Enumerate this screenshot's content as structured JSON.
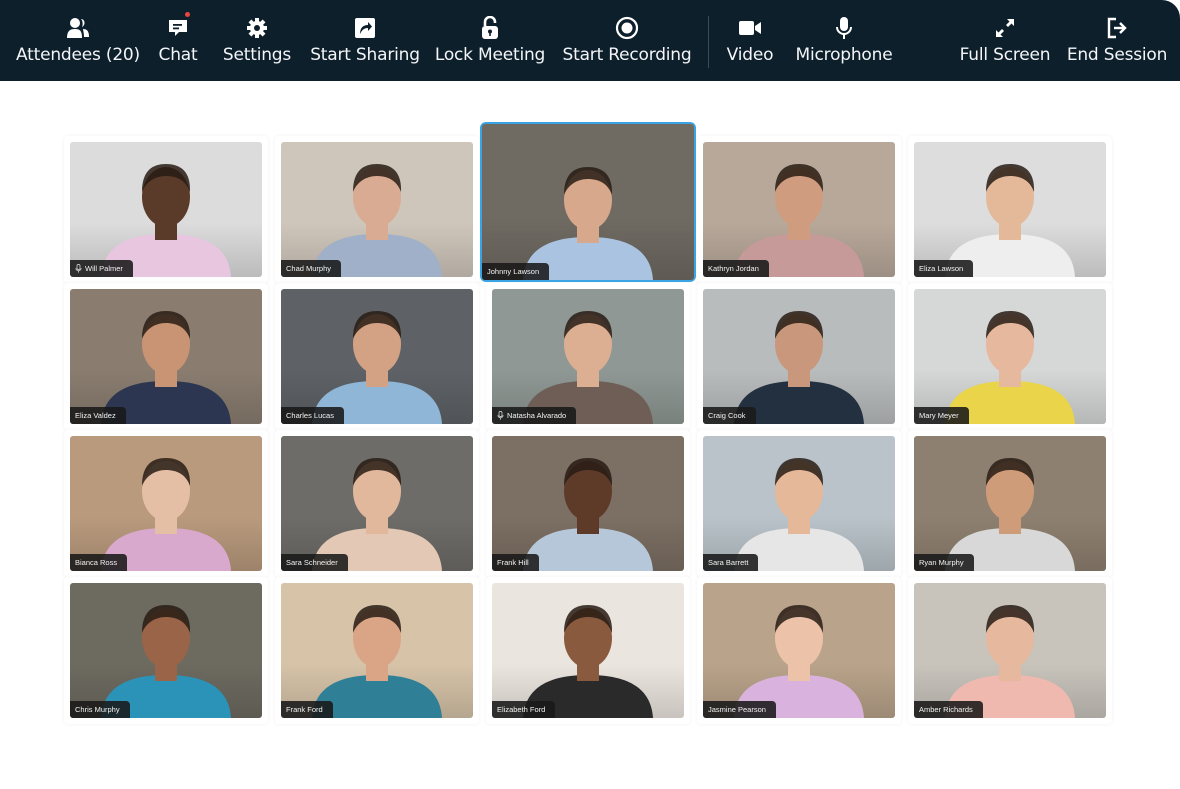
{
  "toolbar": {
    "items": [
      {
        "id": "attendees",
        "label": "Attendees (20)",
        "icon": "users-icon"
      },
      {
        "id": "chat",
        "label": "Chat",
        "icon": "chat-icon",
        "has_notification": true
      },
      {
        "id": "settings",
        "label": "Settings",
        "icon": "gear-icon"
      },
      {
        "id": "start-sharing",
        "label": "Start Sharing",
        "icon": "share-icon"
      },
      {
        "id": "lock-meeting",
        "label": "Lock Meeting",
        "icon": "unlock-icon"
      },
      {
        "id": "start-recording",
        "label": "Start Recording",
        "icon": "record-icon"
      },
      {
        "id": "video",
        "label": "Video",
        "icon": "video-camera-icon"
      },
      {
        "id": "microphone",
        "label": "Microphone",
        "icon": "microphone-icon"
      },
      {
        "id": "full-screen",
        "label": "Full Screen",
        "icon": "expand-icon"
      },
      {
        "id": "end-session",
        "label": "End Session",
        "icon": "exit-icon"
      }
    ],
    "notification_color": "#e8453c"
  },
  "colors": {
    "toolbar_bg": "#0e1f2c",
    "active_speaker_border": "#3aa3e3"
  },
  "participants": [
    {
      "name": "Will Palmer",
      "muted_icon": true,
      "bg": "#dcdcdc",
      "skin": "#5a3a28",
      "shirt": "#e8c6e0"
    },
    {
      "name": "Chad Murphy",
      "muted_icon": false,
      "bg": "#cfc6bb",
      "skin": "#d9ab92",
      "shirt": "#9fb0c8"
    },
    {
      "name": "Johnny Lawson",
      "muted_icon": false,
      "active": true,
      "bg": "#6f6a62",
      "skin": "#d7a88c",
      "shirt": "#a9c3e0"
    },
    {
      "name": "Kathryn Jordan",
      "muted_icon": false,
      "bg": "#b8a89a",
      "skin": "#cf9c80",
      "shirt": "#c79a9a"
    },
    {
      "name": "Eliza Lawson",
      "muted_icon": false,
      "bg": "#dddddd",
      "skin": "#e3b99a",
      "shirt": "#eeeeee"
    },
    {
      "name": "Eliza Valdez",
      "muted_icon": false,
      "bg": "#8a7d70",
      "skin": "#c89474",
      "shirt": "#2d3650"
    },
    {
      "name": "Charles Lucas",
      "muted_icon": false,
      "bg": "#5e6266",
      "skin": "#d3a184",
      "shirt": "#8fb6d6"
    },
    {
      "name": "Natasha Alvarado",
      "muted_icon": true,
      "bg": "#8f9894",
      "skin": "#dcae92",
      "shirt": "#6e5e56"
    },
    {
      "name": "Craig Cook",
      "muted_icon": false,
      "bg": "#b9bcbd",
      "skin": "#c9987c",
      "shirt": "#22303f"
    },
    {
      "name": "Mary Meyer",
      "muted_icon": false,
      "bg": "#d5d8d6",
      "skin": "#e6b89e",
      "shirt": "#e9d44a"
    },
    {
      "name": "Bianca Ross",
      "muted_icon": false,
      "bg": "#b99a7d",
      "skin": "#e5bfa5",
      "shirt": "#d9a9cd"
    },
    {
      "name": "Sara Schneider",
      "muted_icon": false,
      "bg": "#6e6c68",
      "skin": "#e1b89c",
      "shirt": "#e3c8b6"
    },
    {
      "name": "Frank Hill",
      "muted_icon": false,
      "bg": "#7c6f63",
      "skin": "#5e3b28",
      "shirt": "#b5c7d8"
    },
    {
      "name": "Sara Barrett",
      "muted_icon": false,
      "bg": "#b9c3c9",
      "skin": "#e5b899",
      "shirt": "#e6e6e6"
    },
    {
      "name": "Ryan Murphy",
      "muted_icon": false,
      "bg": "#8e8070",
      "skin": "#cf9c7a",
      "shirt": "#d8d8d8"
    },
    {
      "name": "Chris Murphy",
      "muted_icon": false,
      "bg": "#6d6a60",
      "skin": "#9a6448",
      "shirt": "#2b93b8"
    },
    {
      "name": "Frank Ford",
      "muted_icon": false,
      "bg": "#d6c3a8",
      "skin": "#d9a586",
      "shirt": "#2f7f96"
    },
    {
      "name": "Elizabeth Ford",
      "muted_icon": false,
      "bg": "#ebe5df",
      "skin": "#8a5a3e",
      "shirt": "#2a2a2a"
    },
    {
      "name": "Jasmine Pearson",
      "muted_icon": false,
      "bg": "#b9a38a",
      "skin": "#ecc3a8",
      "shirt": "#d9b3dd"
    },
    {
      "name": "Amber Richards",
      "muted_icon": false,
      "bg": "#c8c4bc",
      "skin": "#e6b89e",
      "shirt": "#f0b9b0"
    }
  ]
}
